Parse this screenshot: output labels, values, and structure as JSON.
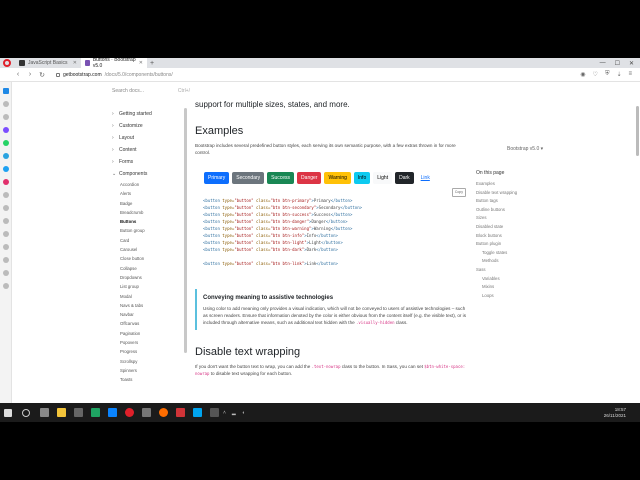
{
  "browser": {
    "tabs": [
      {
        "title": "JavaScript Basics"
      },
      {
        "title": "Buttons · Bootstrap v5.0",
        "active": true
      }
    ],
    "new_tab": "+",
    "url_host": "getbootstrap.com",
    "url_path": "/docs/5.0/components/buttons/"
  },
  "docs": {
    "search_placeholder": "Search docs...",
    "search_kbd": "Ctrl+/",
    "version": "Bootstrap v5.0",
    "nav_groups": [
      {
        "label": "Getting started"
      },
      {
        "label": "Customize"
      },
      {
        "label": "Layout"
      },
      {
        "label": "Content"
      },
      {
        "label": "Forms"
      },
      {
        "label": "Components",
        "expanded": true
      }
    ],
    "components": [
      "Accordion",
      "Alerts",
      "Badge",
      "Breadcrumb",
      "Buttons",
      "Button group",
      "Card",
      "Carousel",
      "Close button",
      "Collapse",
      "Dropdowns",
      "List group",
      "Modal",
      "Navs & tabs",
      "Navbar",
      "Offcanvas",
      "Pagination",
      "Popovers",
      "Progress",
      "Scrollspy",
      "Spinners",
      "Toasts"
    ],
    "active_component": "Buttons"
  },
  "content": {
    "lead": "support for multiple sizes, states, and more.",
    "examples_title": "Examples",
    "examples_text": "Bootstrap includes several predefined button styles, each serving its own semantic purpose, with a few extras thrown in for more control.",
    "buttons": [
      {
        "label": "Primary",
        "bg": "#0d6efd",
        "fg": "#ffffff"
      },
      {
        "label": "Secondary",
        "bg": "#6c757d",
        "fg": "#ffffff"
      },
      {
        "label": "Success",
        "bg": "#198754",
        "fg": "#ffffff"
      },
      {
        "label": "Danger",
        "bg": "#dc3545",
        "fg": "#ffffff"
      },
      {
        "label": "Warning",
        "bg": "#ffc107",
        "fg": "#000000"
      },
      {
        "label": "Info",
        "bg": "#0dcaf0",
        "fg": "#000000"
      },
      {
        "label": "Light",
        "bg": "#f8f9fa",
        "fg": "#000000"
      },
      {
        "label": "Dark",
        "bg": "#212529",
        "fg": "#ffffff"
      },
      {
        "label": "Link",
        "bg": "transparent",
        "fg": "#0d6efd"
      }
    ],
    "copy_label": "Copy",
    "code_lines": [
      {
        "cls": "btn btn-primary",
        "text": "Primary"
      },
      {
        "cls": "btn btn-secondary",
        "text": "Secondary"
      },
      {
        "cls": "btn btn-success",
        "text": "Success"
      },
      {
        "cls": "btn btn-danger",
        "text": "Danger"
      },
      {
        "cls": "btn btn-warning",
        "text": "Warning"
      },
      {
        "cls": "btn btn-info",
        "text": "Info"
      },
      {
        "cls": "btn btn-light",
        "text": "Light"
      },
      {
        "cls": "btn btn-dark",
        "text": "Dark"
      },
      {
        "cls": "btn btn-link",
        "text": "Link",
        "gap_before": true
      }
    ],
    "callout_title": "Conveying meaning to assistive technologies",
    "callout_text_1": "Using color to add meaning only provides a visual indication, which will not be conveyed to users of assistive technologies – such as screen readers. Ensure that information denoted by the color is either obvious from the content itself (e.g. the visible text), or is included through alternative means, such as additional text hidden with the",
    "callout_code": ".visually-hidden",
    "callout_text_2": "class.",
    "wrap_title": "Disable text wrapping",
    "wrap_text_1": "If you don't want the button text to wrap, you can add the",
    "wrap_code_1": ".text-nowrap",
    "wrap_text_2": "class to the button. In Sass, you can set",
    "wrap_code_2": "$btn-white-space: nowrap",
    "wrap_text_3": "to disable text wrapping for each button."
  },
  "toc": {
    "title": "On this page",
    "items": [
      {
        "label": "Examples",
        "level": 1
      },
      {
        "label": "Disable text wrapping",
        "level": 1
      },
      {
        "label": "Button tags",
        "level": 1
      },
      {
        "label": "Outline buttons",
        "level": 1
      },
      {
        "label": "Sizes",
        "level": 1
      },
      {
        "label": "Disabled state",
        "level": 1
      },
      {
        "label": "Block buttons",
        "level": 1
      },
      {
        "label": "Button plugin",
        "level": 1
      },
      {
        "label": "Toggle states",
        "level": 2
      },
      {
        "label": "Methods",
        "level": 2
      },
      {
        "label": "Sass",
        "level": 1
      },
      {
        "label": "Variables",
        "level": 2
      },
      {
        "label": "Mixins",
        "level": 2
      },
      {
        "label": "Loops",
        "level": 2
      }
    ]
  },
  "taskbar": {
    "time": "18:57",
    "date": "26/11/2021"
  }
}
